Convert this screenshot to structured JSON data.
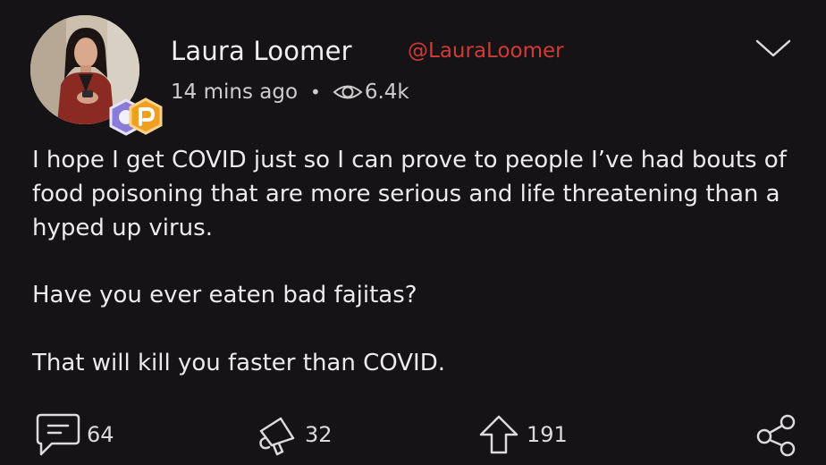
{
  "author": {
    "name": "Laura Loomer",
    "handle": "@LauraLoomer"
  },
  "meta": {
    "time": "14 mins ago",
    "separator": "•",
    "views": "6.4k"
  },
  "body": {
    "paragraphs": [
      "I hope I get COVID just so I can prove to people I’ve had bouts of food poisoning that are more serious and life threatening than a hyped up virus.",
      "Have you ever eaten bad fajitas?",
      "That will kill you faster than COVID."
    ]
  },
  "actions": {
    "comments": "64",
    "echoes": "32",
    "upvotes": "191"
  },
  "colors": {
    "background": "#151315",
    "text": "#ecebec",
    "handle": "#d33a36",
    "badge_orange": "#f0a020",
    "badge_purple": "#8b7bd8"
  },
  "icons": {
    "menu": "chevron-down-icon",
    "views": "eye-icon",
    "comments": "comment-icon",
    "echoes": "echo-megaphone-icon",
    "upvotes": "upvote-arrow-icon",
    "share": "share-icon"
  }
}
